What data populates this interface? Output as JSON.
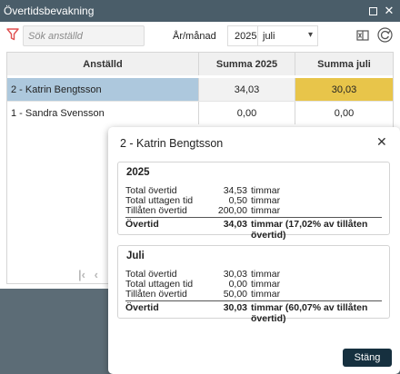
{
  "window": {
    "title": "Övertidsbevakning"
  },
  "toolbar": {
    "search_placeholder": "Sök anställd",
    "year_month_label": "År/månad",
    "year": "2025",
    "month": "juli"
  },
  "table": {
    "headers": [
      "Anställd",
      "Summa 2025",
      "Summa juli"
    ],
    "rows": [
      {
        "employee": "2 - Katrin Bengtsson",
        "sum_year": "34,03",
        "sum_month": "30,03"
      },
      {
        "employee": "1 - Sandra Svensson",
        "sum_year": "0,00",
        "sum_month": "0,00"
      }
    ]
  },
  "dialog": {
    "title": "2 - Katrin Bengtsson",
    "close_label": "Stäng",
    "year_panel": {
      "heading": "2025",
      "lines": [
        {
          "label": "Total övertid",
          "value": "34,53",
          "unit": "timmar"
        },
        {
          "label": "Total uttagen tid",
          "value": "0,50",
          "unit": "timmar"
        },
        {
          "label": "Tillåten övertid",
          "value": "200,00",
          "unit": "timmar"
        }
      ],
      "total": {
        "label": "Övertid",
        "value": "34,03",
        "unit": "timmar (17,02% av tillåten övertid)"
      }
    },
    "month_panel": {
      "heading": "Juli",
      "lines": [
        {
          "label": "Total övertid",
          "value": "30,03",
          "unit": "timmar"
        },
        {
          "label": "Total uttagen tid",
          "value": "0,00",
          "unit": "timmar"
        },
        {
          "label": "Tillåten övertid",
          "value": "50,00",
          "unit": "timmar"
        }
      ],
      "total": {
        "label": "Övertid",
        "value": "30,03",
        "unit": "timmar (60,07% av tillåten övertid)"
      }
    }
  },
  "colors": {
    "titlebar": "#4a5d69",
    "selected_row": "#adc8dd",
    "highlight_cell": "#e8c54a",
    "primary_button": "#16303f"
  },
  "icons": {
    "filter": "filter-icon",
    "excel": "excel-export-icon",
    "refresh": "refresh-icon",
    "restore": "restore-window-icon",
    "close": "close-icon"
  }
}
